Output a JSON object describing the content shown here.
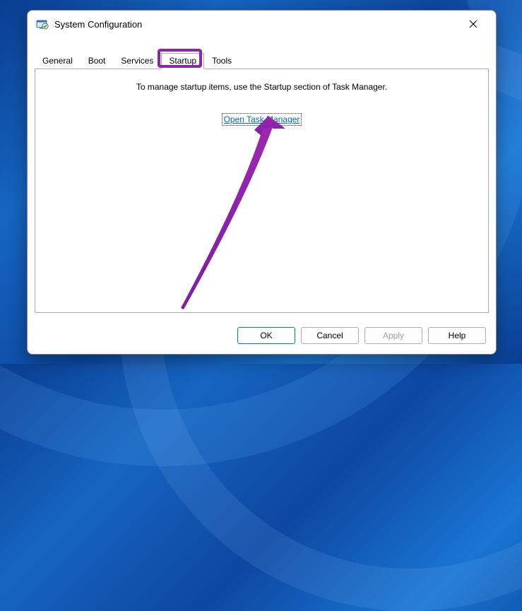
{
  "window": {
    "title": "System Configuration"
  },
  "tabs": {
    "general": "General",
    "boot": "Boot",
    "services": "Services",
    "startup": "Startup",
    "tools": "Tools"
  },
  "content": {
    "instruction": "To manage startup items, use the Startup section of Task Manager.",
    "link": "Open Task Manager"
  },
  "buttons": {
    "ok": "OK",
    "cancel": "Cancel",
    "apply": "Apply",
    "help": "Help"
  },
  "annotation": {
    "highlight_color": "#8e24aa"
  }
}
